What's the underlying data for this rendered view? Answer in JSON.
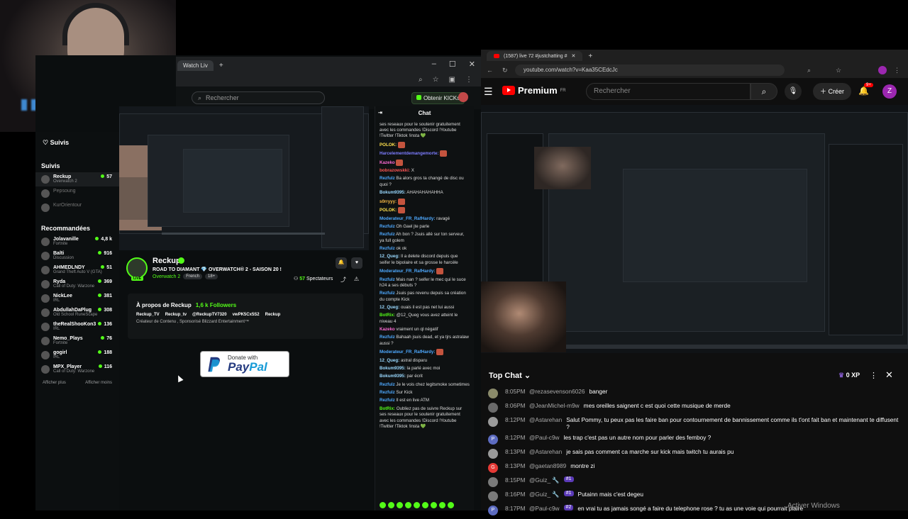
{
  "left_window": {
    "tab_label": "Watch Liv",
    "search_placeholder": "Rechercher",
    "obtenir_label": "Obtenir KICKs",
    "win_min": "–",
    "win_max": "☐",
    "win_close": "✕"
  },
  "sidebar": {
    "suivis_heading": "Suivis",
    "suivis_title": "Suivis",
    "followed": [
      {
        "name": "Reckup",
        "cat": "Overwatch 2",
        "count": "57",
        "live": true
      },
      {
        "name": "Pepsoung",
        "cat": "",
        "count": "",
        "live": false
      },
      {
        "name": "KurOrientour",
        "cat": "",
        "count": "",
        "live": false
      }
    ],
    "recommended_heading": "Recommandées",
    "recommended": [
      {
        "name": "Jolavanille",
        "cat": "Fortnite",
        "count": "4,8 k"
      },
      {
        "name": "Balti",
        "cat": "Discussion",
        "count": "916"
      },
      {
        "name": "AHMEDLNDY",
        "cat": "Grand Theft Auto V (GTA)",
        "count": "51"
      },
      {
        "name": "Ryda",
        "cat": "Call of Duty: Warzone",
        "count": "369"
      },
      {
        "name": "NickLee",
        "cat": "IRL",
        "count": "381"
      },
      {
        "name": "AbdullahDaPlug",
        "cat": "Old School RuneScape",
        "count": "308"
      },
      {
        "name": "theRealShooKon3",
        "cat": "IRL",
        "count": "136"
      },
      {
        "name": "Nemo_Plays",
        "cat": "Fortnite",
        "count": "76"
      },
      {
        "name": "gogirl",
        "cat": "IRL",
        "count": "188"
      },
      {
        "name": "MPX_Player",
        "cat": "Call of Duty: Warzone",
        "count": "116"
      }
    ],
    "show_more": "Afficher plus",
    "show_less": "Afficher moins"
  },
  "stream": {
    "streamer": "Reckup",
    "live_badge": "LIVE",
    "title": "ROAD TO DIAMANT 💎 OVERWATCH® 2 - SAISON 20 !",
    "category": "Overwatch 2",
    "tags": [
      "French",
      "18+"
    ],
    "viewers_count": "57",
    "viewers_label": "Spectateurs"
  },
  "about": {
    "title": "À propos de Reckup",
    "followers": "1,6 k Followers",
    "socials": [
      "Reckup_TV",
      "Reckup_tv",
      "@ReckupTV7320",
      "vwPK5Cx5S2",
      "Reckup"
    ],
    "description": "Créateur de Contenu , Sponsorisé Blizzard Entertainment™"
  },
  "paypal": {
    "donate_with": "Donate with",
    "pay": "Pay",
    "pal": "Pal"
  },
  "chat": {
    "title": "Chat",
    "messages": [
      {
        "user": "",
        "text": "ses reseaux pour le soutenir gratuitement avec les commandes !Discord !Youtube !Twitter !Tiktok !insta 💚",
        "color": "#ddd"
      },
      {
        "user": "POLOK:",
        "text": "",
        "color": "#ffe14d"
      },
      {
        "user": "Harcelementdemangemorte:",
        "text": "",
        "color": "#7d7dff"
      },
      {
        "user": "Kazeko",
        "text": "",
        "color": "#ff6bd6"
      },
      {
        "user": "bobrazowskki:",
        "text": "X",
        "color": "#ff5555"
      },
      {
        "user": "Rezfulz",
        "text": "Ba alors gros ta changé de disc ou quoi ?",
        "color": "#4ea9ff"
      },
      {
        "user": "Bokum9395:",
        "text": "AHAHAHAHAHHA",
        "color": "#9ad9ff"
      },
      {
        "user": "s0rryyy:",
        "text": "",
        "color": "#ffbf47"
      },
      {
        "user": "POLOK:",
        "text": "",
        "color": "#ffe14d"
      },
      {
        "user": "Moderateur_FR_RafHardy:",
        "text": "ravagé",
        "color": "#4ea9ff"
      },
      {
        "user": "Rezfulz",
        "text": "Oh Gael jte parle",
        "color": "#4ea9ff"
      },
      {
        "user": "Rezfulz",
        "text": "Ah bon ? Jsuis allé sur ton serveur, ya full golem",
        "color": "#4ea9ff"
      },
      {
        "user": "Rezfulz",
        "text": "ok ok",
        "color": "#4ea9ff"
      },
      {
        "user": "12_Queg:",
        "text": "Il a delete discord depuis que seifer le bipolaire et sa grosse le harcèle",
        "color": "#9ad9ff"
      },
      {
        "user": "Moderateur_FR_RafHardy:",
        "text": "",
        "color": "#4ea9ff"
      },
      {
        "user": "Rezfulz",
        "text": "Mais nan ? seifer le mec qui le suce h24 a ses débuts ?",
        "color": "#4ea9ff"
      },
      {
        "user": "Rezfulz",
        "text": "Jsuis pas revenu depuis sa création du compte Kick",
        "color": "#4ea9ff"
      },
      {
        "user": "12_Queg:",
        "text": "ouais il est pas net lui aussi",
        "color": "#9ad9ff"
      },
      {
        "user": "BotRix:",
        "text": "@12_Queg vous avez atteint le niveau 4",
        "color": "#53fc18"
      },
      {
        "user": "Kazeko",
        "text": "vraiment un ql négatif",
        "color": "#ff6bd6"
      },
      {
        "user": "Rezfulz",
        "text": "Bahaah jsuis dead, et ya tjrs astralaw aussi ?",
        "color": "#4ea9ff"
      },
      {
        "user": "Moderateur_FR_RafHardy:",
        "text": "",
        "color": "#4ea9ff"
      },
      {
        "user": "12_Queg:",
        "text": "astral disparu",
        "color": "#9ad9ff"
      },
      {
        "user": "Bokum9395:",
        "text": "la parlé avec moi",
        "color": "#9ad9ff"
      },
      {
        "user": "Bokum9395:",
        "text": "par écrit",
        "color": "#9ad9ff"
      },
      {
        "user": "Rezfulz",
        "text": "Je le vois chez legitsmoke sometimes",
        "color": "#4ea9ff"
      },
      {
        "user": "Rezfulz",
        "text": "Sur Kick",
        "color": "#4ea9ff"
      },
      {
        "user": "Rezfulz",
        "text": "Il est en live ATM",
        "color": "#4ea9ff"
      },
      {
        "user": "BotRix:",
        "text": "Oubliez pas de suivre Reckup sur ses reseaux pour le soutenir gratuitement avec les commandes !Discord !Youtube !Twitter !Tiktok !insta 💚",
        "color": "#53fc18"
      }
    ]
  },
  "right_window": {
    "tab_label": "(1587) live 72 #justchatting #",
    "url": "youtube.com/watch?v=Kaa35CEdcJc",
    "premium": "Premium",
    "premium_region": "FR",
    "search_placeholder": "Rechercher",
    "create_label": "Créer",
    "notif_count": "9+",
    "user_initial": "Z"
  },
  "yt_chat": {
    "title": "Top Chat",
    "xp": "0 XP",
    "messages": [
      {
        "time": "8:05PM",
        "user": "@rezasevenson6026",
        "badge": "",
        "text": "banger",
        "avatar": "#8a8a6a",
        "initial": ""
      },
      {
        "time": "8:06PM",
        "user": "@JeanMichel-m9w",
        "badge": "",
        "text": "mes oreilles saignent c est quoi cette musique de merde",
        "avatar": "#6a6a6a",
        "initial": ""
      },
      {
        "time": "8:12PM",
        "user": "@Astarehan",
        "badge": "",
        "text": "Salut Pommy, tu peux pas les faire ban pour contournement de bannissement comme ils t'ont fait ban et maintenant te diffusent ?",
        "avatar": "#9a9a9a",
        "initial": ""
      },
      {
        "time": "8:12PM",
        "user": "@Paul-c9w",
        "badge": "",
        "text": "les trap c'est pas un autre nom pour parler des femboy ?",
        "avatar": "#5c6bc0",
        "initial": "P"
      },
      {
        "time": "8:13PM",
        "user": "@Astarehan",
        "badge": "",
        "text": "je sais pas comment ca marche sur kick mais twitch tu aurais pu",
        "avatar": "#9a9a9a",
        "initial": ""
      },
      {
        "time": "8:13PM",
        "user": "@gaetan8989",
        "badge": "",
        "text": "montre zi",
        "avatar": "#e53935",
        "initial": "G"
      },
      {
        "time": "8:15PM",
        "user": "@Guiz_ 🔧",
        "badge": "#1",
        "text": "",
        "avatar": "#7a7a7a",
        "initial": ""
      },
      {
        "time": "8:16PM",
        "user": "@Guiz_ 🔧",
        "badge": "#1",
        "text": "Putainn mais c'est degeu",
        "avatar": "#7a7a7a",
        "initial": ""
      },
      {
        "time": "8:17PM",
        "user": "@Paul-c9w",
        "badge": "#2",
        "text": "en vrai tu as jamais songé a faire du telephone rose ? tu as une voie qui pourrait plaire",
        "avatar": "#5c6bc0",
        "initial": "P"
      }
    ]
  },
  "activate_windows": "Activer Windows",
  "colors": {
    "kick_green": "#53fc18",
    "yt_red": "#ff0000"
  }
}
